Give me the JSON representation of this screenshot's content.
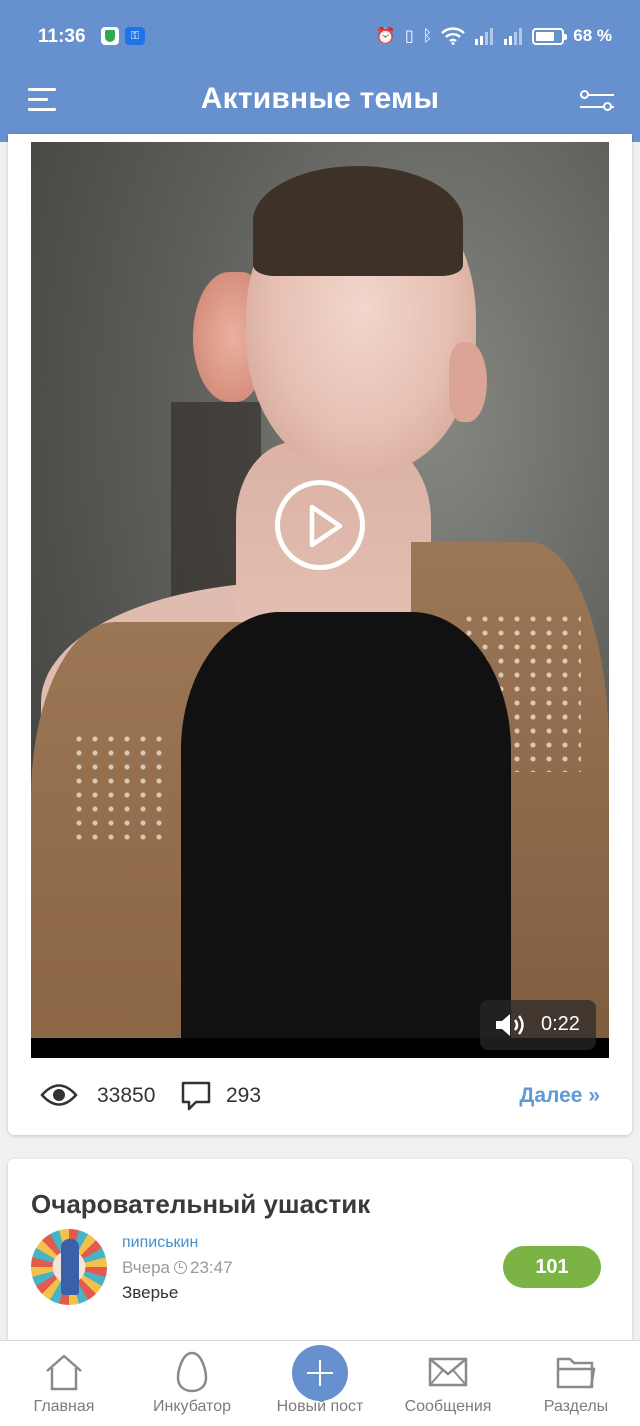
{
  "status_bar": {
    "time": "11:36",
    "battery": "68 %",
    "icons": [
      "vpn-shield-icon",
      "key-icon",
      "alarm-icon",
      "vibrate-icon",
      "bluetooth-icon",
      "wifi-icon",
      "signal-icon",
      "signal-icon",
      "battery-icon"
    ]
  },
  "header": {
    "title": "Активные темы",
    "menu_icon": "hamburger-menu-icon",
    "filter_icon": "filter-sliders-icon",
    "bg_color": "#6790cf"
  },
  "post1": {
    "video": {
      "duration": "0:22",
      "play_icon": "play-circle-icon",
      "sound_icon": "speaker-icon"
    },
    "views": "33850",
    "comments": "293",
    "more_label": "Далее »",
    "link_color": "#5c9ad8"
  },
  "post2": {
    "title": "Очаровательный ушастик",
    "author": "пиписькин",
    "date": "Вчера",
    "time": "23:47",
    "category": "Зверье",
    "rating": "101",
    "rating_color": "#7bb444"
  },
  "bottom_nav": {
    "items": [
      {
        "label": "Главная",
        "icon": "home-icon"
      },
      {
        "label": "Инкубатор",
        "icon": "egg-icon"
      },
      {
        "label": "Новый пост",
        "icon": "plus-circle-icon"
      },
      {
        "label": "Сообщения",
        "icon": "envelope-icon"
      },
      {
        "label": "Разделы",
        "icon": "folder-icon"
      }
    ]
  }
}
